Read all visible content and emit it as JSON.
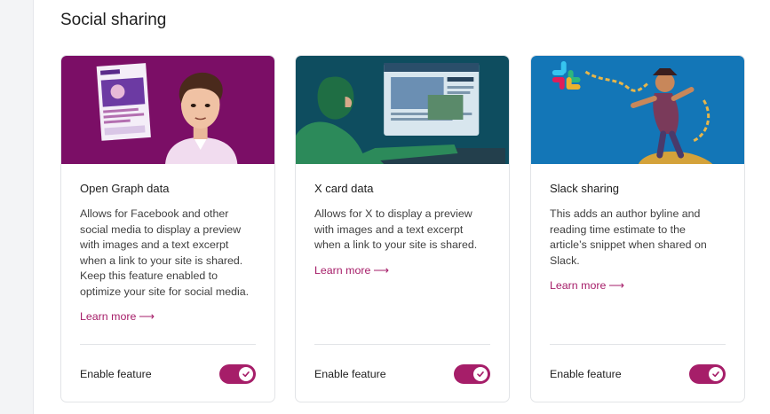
{
  "section": {
    "title": "Social sharing"
  },
  "colors": {
    "accent": "#a61e69",
    "og_bg": "#7b0e66",
    "x_bg": "#0e4d5f",
    "slack_bg": "#1376b7"
  },
  "cards": [
    {
      "title": "Open Graph data",
      "description": "Allows for Facebook and other social media to display a preview with images and a text excerpt when a link to your site is shared. Keep this feature enabled to optimize your site for social media.",
      "learn_more": "Learn more",
      "arrow": "⟶",
      "enable_label": "Enable feature",
      "enabled": true,
      "image_icon": "open-graph-illustration"
    },
    {
      "title": "X card data",
      "description": "Allows for X to display a preview with images and a text excerpt when a link to your site is shared.",
      "learn_more": "Learn more",
      "arrow": "⟶",
      "enable_label": "Enable feature",
      "enabled": true,
      "image_icon": "x-card-illustration"
    },
    {
      "title": "Slack sharing",
      "description": "This adds an author byline and reading time estimate to the article’s snippet when shared on Slack.",
      "learn_more": "Learn more",
      "arrow": "⟶",
      "enable_label": "Enable feature",
      "enabled": true,
      "image_icon": "slack-pirate-illustration"
    }
  ]
}
